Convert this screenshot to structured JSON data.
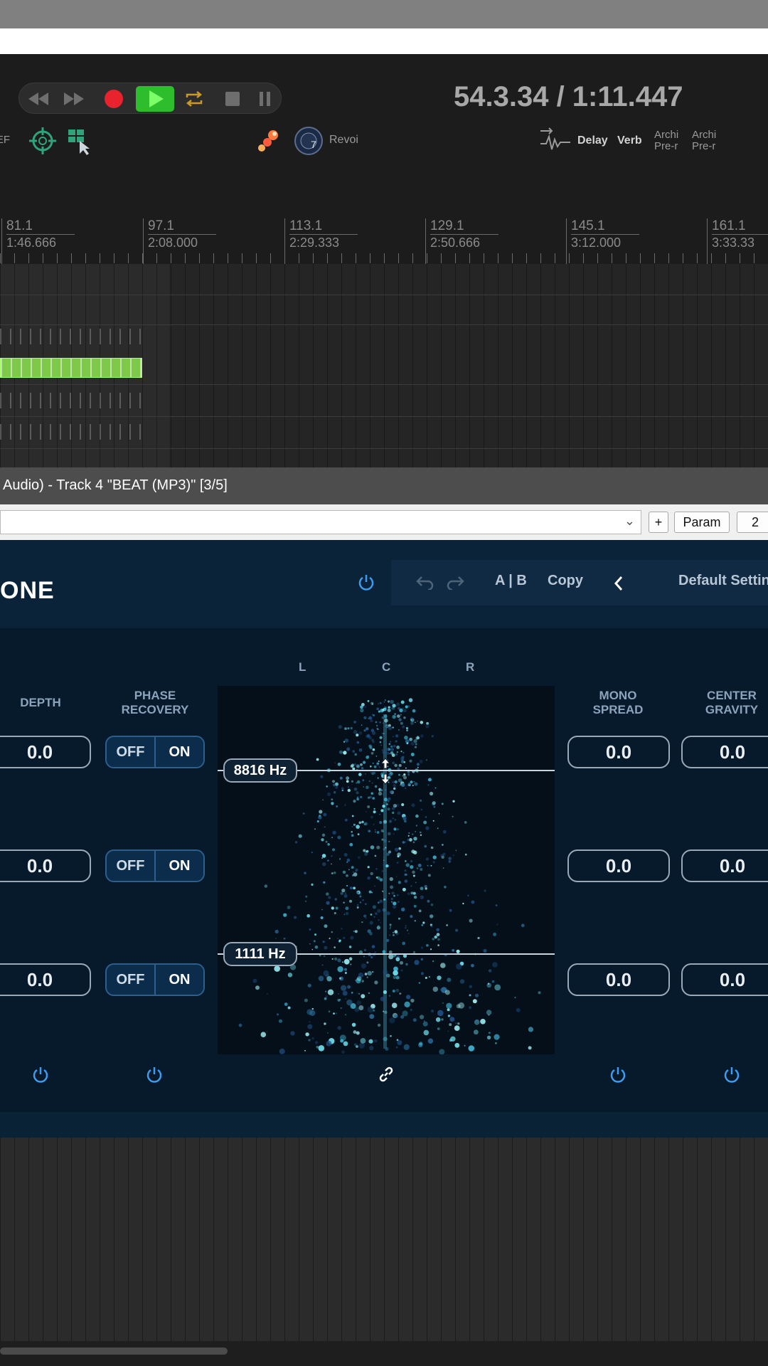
{
  "transport": {
    "timecode": "54.3.34 / 1:11.447",
    "ref_label": "REF",
    "revoice_label": "Revoi",
    "fx": {
      "delay": "Delay",
      "verb": "Verb",
      "archi1": "Archi\nPre-r",
      "archi2": "Archi\nPre-r"
    },
    "colors": {
      "record": "#e8232d",
      "play": "#2dbd2d"
    }
  },
  "ruler": {
    "markers": [
      {
        "bar": "81.1",
        "time": "1:46.666"
      },
      {
        "bar": "97.1",
        "time": "2:08.000"
      },
      {
        "bar": "113.1",
        "time": "2:29.333"
      },
      {
        "bar": "129.1",
        "time": "2:50.666"
      },
      {
        "bar": "145.1",
        "time": "3:12.000"
      },
      {
        "bar": "161.1",
        "time": "3:33.33"
      }
    ]
  },
  "window": {
    "title": "Audio) - Track 4 \"BEAT (MP3)\" [3/5]",
    "add_btn": "+",
    "param_btn": "Param",
    "num_field": "2"
  },
  "plugin": {
    "brand": "ONE",
    "header": {
      "ab": "A | B",
      "copy": "Copy",
      "preset": "Default Settin"
    },
    "columns": {
      "depth": "DEPTH",
      "phase_recovery": "PHASE\nRECOVERY",
      "mono_spread": "MONO\nSPREAD",
      "center_gravity": "CENTER\nGRAVITY"
    },
    "rows": [
      {
        "depth": "0.0",
        "off": "OFF",
        "on": "ON",
        "mono": "0.0",
        "center": "0.0"
      },
      {
        "depth": "0.0",
        "off": "OFF",
        "on": "ON",
        "mono": "0.0",
        "center": "0.0"
      },
      {
        "depth": "0.0",
        "off": "OFF",
        "on": "ON",
        "mono": "0.0",
        "center": "0.0"
      }
    ],
    "scope": {
      "l": "L",
      "c": "C",
      "r": "R",
      "crossover_high": "8816 Hz",
      "crossover_low": "1111 Hz"
    },
    "accent": "#3e9cf0"
  }
}
